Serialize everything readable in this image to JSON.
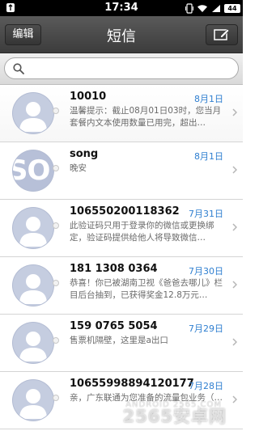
{
  "status_bar": {
    "time": "17:34",
    "battery_level": "44",
    "icons": [
      "usb-notification-icon",
      "vibrate-icon",
      "wifi-icon",
      "signal-icon",
      "battery-icon"
    ]
  },
  "nav": {
    "edit_label": "编辑",
    "title": "短信",
    "compose_icon": "compose-icon"
  },
  "search": {
    "placeholder": "",
    "icon": "search-icon"
  },
  "messages": [
    {
      "sender": "10010",
      "date": "8月1日",
      "preview": "温馨提示：截止08月01日03时，您当月套餐内文本使用数量已用完，超出…",
      "avatar": "default-avatar"
    },
    {
      "sender": "song",
      "date": "8月1日",
      "preview": "晚安",
      "avatar_text": "SO"
    },
    {
      "sender": "106550200118362",
      "date": "7月31日",
      "preview": "此验证码只用于登录你的微信或更换绑定，验证码提供给他人将导致微信…",
      "avatar": "default-avatar"
    },
    {
      "sender": "181 1308 0364",
      "date": "7月30日",
      "preview": "恭喜！你已被湖南卫视《爸爸去哪儿》栏目后台抽到，已获得奖金12.8万元…",
      "avatar": "default-avatar"
    },
    {
      "sender": "159 0765 5054",
      "date": "7月29日",
      "preview": "售票机隔壁，这里是a出口",
      "avatar": "default-avatar"
    },
    {
      "sender": "10655998894120177",
      "date": "7月28日",
      "preview": "亲，广东联通为您准备的流量包业务（…",
      "avatar": "default-avatar"
    }
  ],
  "watermark": {
    "small": "ANDROID 2565.COM",
    "large": "2565安卓网"
  },
  "colors": {
    "date_blue": "#2f7fd0",
    "nav_dark": "#3c3c3c",
    "avatar_bg": "#c5cde0"
  }
}
